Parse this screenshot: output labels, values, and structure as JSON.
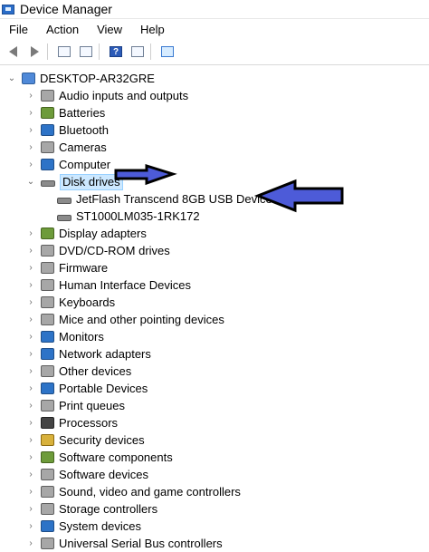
{
  "window": {
    "title": "Device Manager",
    "icon": "device-manager-icon"
  },
  "menu": [
    "File",
    "Action",
    "View",
    "Help"
  ],
  "toolbar": {
    "buttons": [
      "back-icon",
      "forward-icon",
      "properties-icon",
      "update-driver-icon",
      "help-icon",
      "show-hidden-icon",
      "scan-hardware-icon"
    ]
  },
  "tree": {
    "root": "DESKTOP-AR32GRE",
    "items": [
      {
        "label": "Audio inputs and outputs",
        "icon": "audio-icon"
      },
      {
        "label": "Batteries",
        "icon": "battery-icon"
      },
      {
        "label": "Bluetooth",
        "icon": "bluetooth-icon"
      },
      {
        "label": "Cameras",
        "icon": "camera-icon"
      },
      {
        "label": "Computer",
        "icon": "computer-icon"
      },
      {
        "label": "Disk drives",
        "icon": "disk-icon",
        "expanded": true
      },
      {
        "label": "JetFlash Transcend 8GB USB Device",
        "icon": "usb-drive-icon",
        "child": true
      },
      {
        "label": "ST1000LM035-1RK172",
        "icon": "hard-drive-icon",
        "child": true
      },
      {
        "label": "Display adapters",
        "icon": "display-adapter-icon"
      },
      {
        "label": "DVD/CD-ROM drives",
        "icon": "dvd-icon"
      },
      {
        "label": "Firmware",
        "icon": "firmware-icon"
      },
      {
        "label": "Human Interface Devices",
        "icon": "hid-icon"
      },
      {
        "label": "Keyboards",
        "icon": "keyboard-icon"
      },
      {
        "label": "Mice and other pointing devices",
        "icon": "mouse-icon"
      },
      {
        "label": "Monitors",
        "icon": "monitor-icon"
      },
      {
        "label": "Network adapters",
        "icon": "network-icon"
      },
      {
        "label": "Other devices",
        "icon": "other-devices-icon"
      },
      {
        "label": "Portable Devices",
        "icon": "portable-devices-icon"
      },
      {
        "label": "Print queues",
        "icon": "printer-icon"
      },
      {
        "label": "Processors",
        "icon": "processor-icon"
      },
      {
        "label": "Security devices",
        "icon": "security-icon"
      },
      {
        "label": "Software components",
        "icon": "software-components-icon"
      },
      {
        "label": "Software devices",
        "icon": "software-devices-icon"
      },
      {
        "label": "Sound, video and game controllers",
        "icon": "sound-icon"
      },
      {
        "label": "Storage controllers",
        "icon": "storage-icon"
      },
      {
        "label": "System devices",
        "icon": "system-devices-icon"
      },
      {
        "label": "Universal Serial Bus controllers",
        "icon": "usb-controller-icon"
      }
    ]
  },
  "colors": {
    "selection": "#cce8ff",
    "arrow": "#4d5bd8"
  }
}
